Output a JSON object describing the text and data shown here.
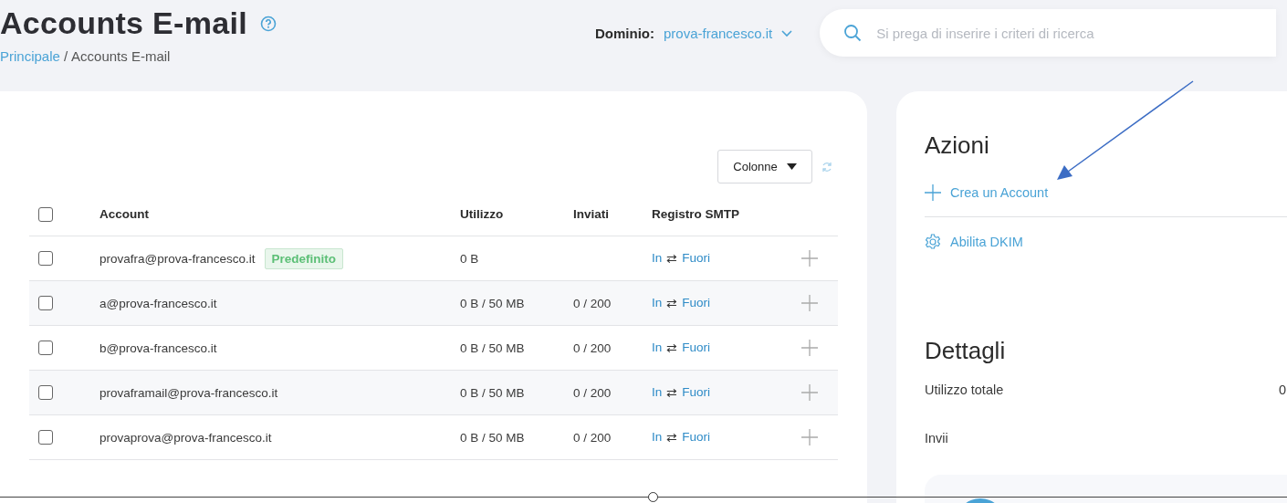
{
  "header": {
    "title": "Accounts E-mail",
    "breadcrumb": [
      {
        "label": "Principale",
        "kind": "link"
      },
      {
        "label": "/",
        "kind": "separator"
      },
      {
        "label": "Accounts E-mail",
        "kind": "current"
      }
    ],
    "domain_label": "Dominio:",
    "domain_value": "prova-francesco.it",
    "search": {
      "placeholder": "Si prega di inserire i criteri di ricerca"
    }
  },
  "table": {
    "columns_button": "Colonne",
    "header_checkbox": {
      "checked": false
    },
    "columns": [
      "Account",
      "Utilizzo",
      "Inviati",
      "Registro SMTP"
    ],
    "rows": [
      {
        "checked": false,
        "account": "provafra@prova-francesco.it",
        "badge": "Predefinito",
        "usage": "0 B",
        "smtp": {
          "in": "In",
          "sep": "⇄",
          "out": "Fuori"
        }
      },
      {
        "checked": false,
        "account": "a@prova-francesco.it",
        "usage": "0 B / 50 MB",
        "sent": "0 / 200",
        "smtp": {
          "in": "In",
          "sep": "⇄",
          "out": "Fuori"
        }
      },
      {
        "checked": false,
        "account": "b@prova-francesco.it",
        "usage": "0 B / 50 MB",
        "sent": "0 / 200",
        "smtp": {
          "in": "In",
          "sep": "⇄",
          "out": "Fuori"
        }
      },
      {
        "checked": false,
        "account": "provaframail@prova-francesco.it",
        "usage": "0 B / 50 MB",
        "sent": "0 / 200",
        "smtp": {
          "in": "In",
          "sep": "⇄",
          "out": "Fuori"
        }
      },
      {
        "checked": false,
        "account": "provaprova@prova-francesco.it",
        "usage": "0 B / 50 MB",
        "sent": "0 / 200",
        "smtp": {
          "in": "In",
          "sep": "⇄",
          "out": "Fuori"
        }
      }
    ]
  },
  "side": {
    "actions_title": "Azioni",
    "actions": [
      {
        "kind": "add",
        "label": "Crea un Account"
      },
      {
        "kind": "settings",
        "label": "Abilita DKIM"
      }
    ],
    "details_title": "Dettagli",
    "details": [
      {
        "label": "Utilizzo totale",
        "value": "0"
      },
      {
        "label": "Invii"
      }
    ]
  }
}
